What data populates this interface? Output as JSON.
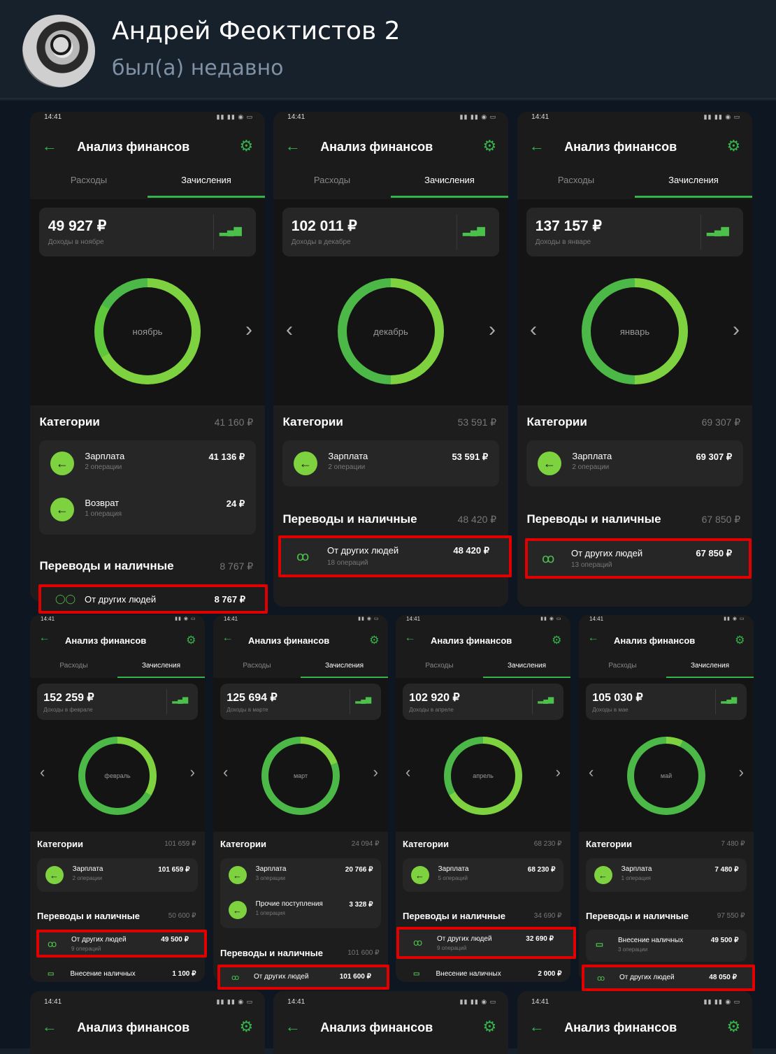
{
  "chat": {
    "contact_name": "Андрей Феоктистов 2",
    "contact_status": "был(а) недавно"
  },
  "screen_common": {
    "time": "14:41",
    "title": "Анализ финансов",
    "tab_expenses": "Расходы",
    "tab_income": "Зачисления",
    "categories_label": "Категории",
    "transfers_label": "Переводы и наличные",
    "salary_label": "Зарплата",
    "refund_label": "Возврат",
    "other_income_label": "Прочие поступления",
    "from_people_label": "От других людей",
    "cash_deposit_label": "Внесение наличных"
  },
  "screens": [
    {
      "amount": "49 927 ₽",
      "sub": "Доходы в ноябре",
      "month": "ноябрь",
      "cat_sum": "41 160 ₽",
      "cat1_val": "41 136 ₽",
      "cat1_sub": "2 операции",
      "cat2_val": "24 ₽",
      "cat2_sub": "1 операция",
      "tr_sum": "8 767 ₽",
      "people_val": "8 767 ₽"
    },
    {
      "amount": "102 011 ₽",
      "sub": "Доходы в декабре",
      "month": "декабрь",
      "cat_sum": "53 591 ₽",
      "cat1_val": "53 591 ₽",
      "cat1_sub": "2 операции",
      "tr_sum": "48 420 ₽",
      "people_val": "48 420 ₽",
      "people_sub": "18 операций"
    },
    {
      "amount": "137 157 ₽",
      "sub": "Доходы в январе",
      "month": "январь",
      "cat_sum": "69 307 ₽",
      "cat1_val": "69 307 ₽",
      "cat1_sub": "2 операции",
      "tr_sum": "67 850 ₽",
      "people_val": "67 850 ₽",
      "people_sub": "13 операций"
    },
    {
      "amount": "152 259 ₽",
      "sub": "Доходы в феврале",
      "month": "февраль",
      "cat_sum": "101 659 ₽",
      "cat1_val": "101 659 ₽",
      "cat1_sub": "2 операции",
      "tr_sum": "50 600 ₽",
      "people_val": "49 500 ₽",
      "people_sub": "9 операций",
      "extra_val": "1 100 ₽"
    },
    {
      "amount": "125 694 ₽",
      "sub": "Доходы в марте",
      "month": "март",
      "cat_sum": "24 094 ₽",
      "cat1_val": "20 766 ₽",
      "cat1_sub": "3 операции",
      "cat2_val": "3 328 ₽",
      "cat2_sub": "1 операция",
      "tr_sum": "101 600 ₽",
      "people_val": "101 600 ₽"
    },
    {
      "amount": "102 920 ₽",
      "sub": "Доходы в апреле",
      "month": "апрель",
      "cat_sum": "68 230 ₽",
      "cat1_val": "68 230 ₽",
      "cat1_sub": "5 операций",
      "tr_sum": "34 690 ₽",
      "people_val": "32 690 ₽",
      "people_sub": "9 операций",
      "extra_val": "2 000 ₽"
    },
    {
      "amount": "105 030 ₽",
      "sub": "Доходы в мае",
      "month": "май",
      "cat_sum": "7 480 ₽",
      "cat1_val": "7 480 ₽",
      "cat1_sub": "1 операция",
      "tr_sum": "97 550 ₽",
      "cash_val": "49 500 ₽",
      "cash_sub": "3 операции",
      "people_val": "48 050 ₽"
    }
  ],
  "colors": {
    "accent": "#36b24a",
    "ring": "#7ed23f",
    "highlight": "#e00000",
    "chat_bg": "#17212b"
  }
}
